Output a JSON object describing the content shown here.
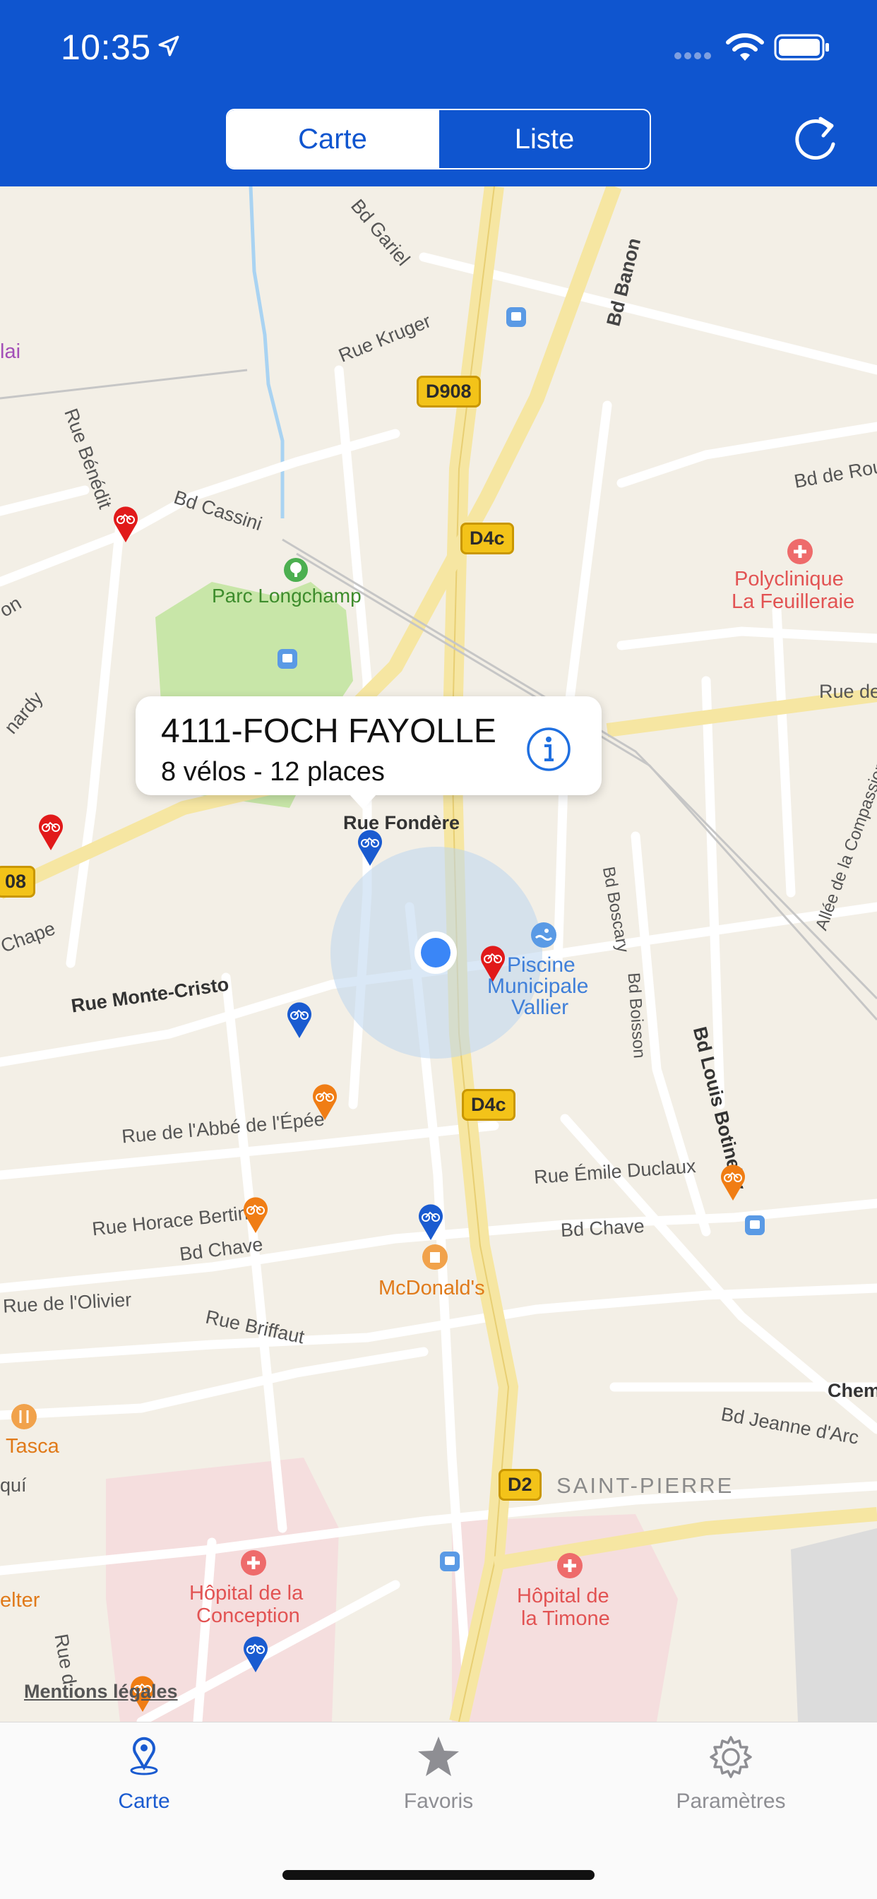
{
  "status_bar": {
    "time": "10:35"
  },
  "header": {
    "segments": [
      {
        "label": "Carte",
        "active": true
      },
      {
        "label": "Liste",
        "active": false
      }
    ],
    "refresh_icon": "refresh-icon"
  },
  "callout": {
    "title": "4111-FOCH FAYOLLE",
    "subtitle": "8 vélos - 12 places",
    "info_icon": "info-icon"
  },
  "map": {
    "streets": [
      "Bd Gariel",
      "Bd Banon",
      "Rue Kruger",
      "Rue Bénédit",
      "Bd Cassini",
      "Bd de Rou",
      "Rue de",
      "Allée de la Compassion",
      "Rue Fondère",
      "Bd Boscary",
      "Bd Boisson",
      "Bd Louis Botinelly",
      "Rue Monte-Cristo",
      "Rue de l'Abbé de l'Épée",
      "Rue Émile Duclaux",
      "Rue Horace Bertin",
      "Bd Chave",
      "Bd Chave",
      "Rue de l'Olivier",
      "Rue Briffaut",
      "Bd Jeanne d'Arc",
      "Chem",
      "Chape",
      "nardy",
      "on",
      "quí",
      "Rue d"
    ],
    "roads": [
      "D908",
      "D4c",
      "D4c",
      "D2",
      "08"
    ],
    "places": {
      "park": "Parc Longchamp",
      "clinic": [
        "Polyclinique",
        "La Feuilleraie"
      ],
      "pool": [
        "Piscine",
        "Municipale",
        "Vallier"
      ],
      "restaurant": "McDonald's",
      "tasca": "Tasca",
      "hospital1": [
        "Hôpital de la",
        "Conception"
      ],
      "hospital2": [
        "Hôpital de",
        "la Timone"
      ],
      "district": "SAINT-PIERRE",
      "elter": "elter",
      "lai": "lai"
    },
    "legal": "Mentions légales",
    "colors": {
      "red": "#e11a1a",
      "orange": "#f07d14",
      "blue": "#1a5bd0",
      "user": "#3a86f7"
    }
  },
  "tabbar": {
    "tabs": [
      {
        "label": "Carte",
        "icon": "map-pin-icon",
        "active": true
      },
      {
        "label": "Favoris",
        "icon": "star-icon",
        "active": false
      },
      {
        "label": "Paramètres",
        "icon": "gear-icon",
        "active": false
      }
    ]
  }
}
